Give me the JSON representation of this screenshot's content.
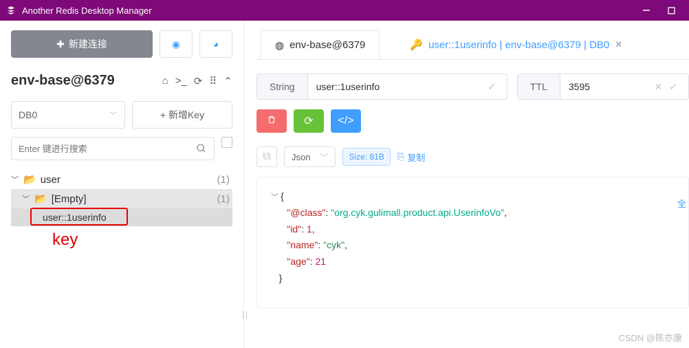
{
  "title": "Another Redis Desktop Manager",
  "sidebar": {
    "new_conn": "新建连接",
    "conn_name": "env-base@6379",
    "db_label": "DB0",
    "add_key": "+ 新增Key",
    "search_ph": "Enter 键进行搜索",
    "tree": {
      "folder1": "user",
      "count1": "(1)",
      "folder2": "[Empty]",
      "count2": "(1)",
      "key": "user::1userinfo"
    },
    "annotation": "key"
  },
  "tabs": {
    "home": "env-base@6379",
    "active": "user::1userinfo | env-base@6379 | DB0"
  },
  "detail": {
    "type": "String",
    "keyname": "user::1userinfo",
    "ttl_label": "TTL",
    "ttl_value": "3595",
    "tree_icon": "⇅",
    "format": "Json",
    "size": "Size: 81B",
    "copy": "复制"
  },
  "json": {
    "class_k": "\"@class\"",
    "class_v": "\"org.cyk.gulimall.product.api.UserinfoVo\"",
    "id_k": "\"id\"",
    "id_v": "1",
    "name_k": "\"name\"",
    "name_v": "\"cyk\"",
    "age_k": "\"age\"",
    "age_v": "21"
  },
  "quan": "全",
  "watermark": "CSDN @陈亦康"
}
